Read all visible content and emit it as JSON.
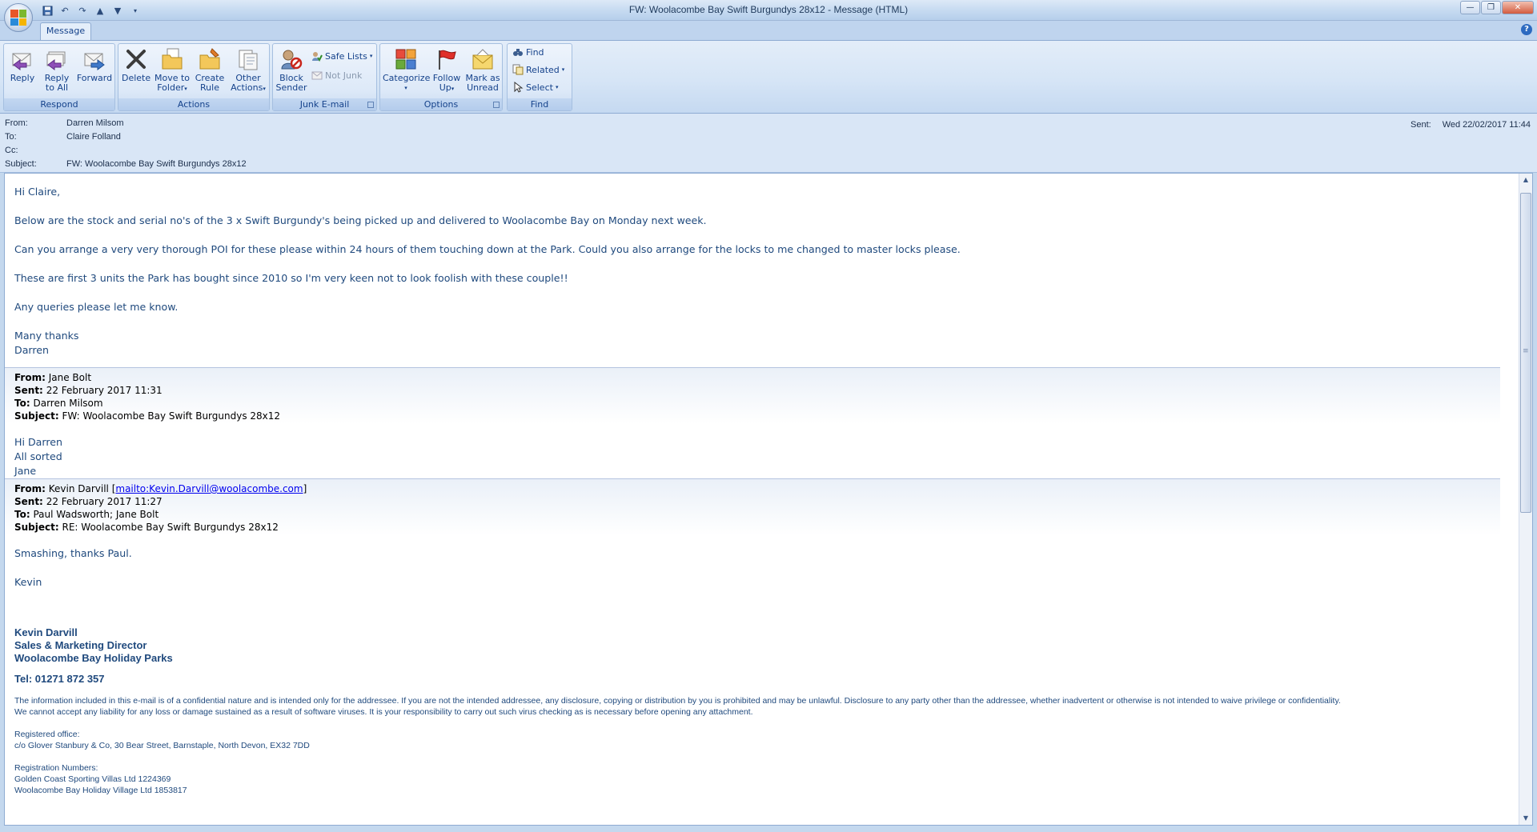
{
  "window": {
    "title": "FW: Woolacombe Bay  Swift Burgundys 28x12  -  Message (HTML)"
  },
  "tabs": [
    {
      "label": "Message"
    }
  ],
  "ribbon": {
    "respond": {
      "label": "Respond",
      "reply": "Reply",
      "reply_all_1": "Reply",
      "reply_all_2": "to All",
      "forward": "Forward"
    },
    "actions": {
      "label": "Actions",
      "delete": "Delete",
      "move_1": "Move to",
      "move_2": "Folder",
      "create_1": "Create",
      "create_2": "Rule",
      "other_1": "Other",
      "other_2": "Actions"
    },
    "junk": {
      "label": "Junk E-mail",
      "block_1": "Block",
      "block_2": "Sender",
      "safe_lists": "Safe Lists",
      "not_junk": "Not Junk"
    },
    "options": {
      "label": "Options",
      "categorize": "Categorize",
      "follow_1": "Follow",
      "follow_2": "Up",
      "mark_1": "Mark as",
      "mark_2": "Unread"
    },
    "find": {
      "label": "Find",
      "find": "Find",
      "related": "Related",
      "select": "Select"
    }
  },
  "header": {
    "from_label": "From:",
    "from": "Darren Milsom",
    "to_label": "To:",
    "to": "Claire Folland",
    "cc_label": "Cc:",
    "cc": "",
    "subject_label": "Subject:",
    "subject": "FW: Woolacombe Bay  Swift Burgundys 28x12",
    "sent_label": "Sent:",
    "sent": "Wed 22/02/2017 11:44"
  },
  "message": {
    "greeting": "Hi Claire,",
    "p1": "Below are the stock and serial no's of the 3 x Swift Burgundy's being picked up and delivered to Woolacombe Bay on Monday next week.",
    "p2": "Can you arrange a very very thorough POI for these please within 24 hours of them touching down at the Park. Could you also arrange for the locks to me changed to master locks please.",
    "p3": "These are first 3 units the Park has bought since 2010 so I'm very keen not to look foolish with these couple!!",
    "p4": "Any queries please let me know.",
    "signoff": "Many thanks",
    "name": "Darren"
  },
  "quote1": {
    "from_label": "From:",
    "from": "Jane Bolt",
    "sent_label": "Sent:",
    "sent": "22 February 2017 11:31",
    "to_label": "To:",
    "to": "Darren Milsom",
    "subject_label": "Subject:",
    "subject": "FW: Woolacombe Bay Swift Burgundys 28x12",
    "line1": "Hi Darren",
    "line2": "All sorted",
    "line3": "Jane"
  },
  "quote2": {
    "from_label": "From:",
    "from": "Kevin Darvill [",
    "from_link": "mailto:Kevin.Darvill@woolacombe.com",
    "from_end": "]",
    "sent_label": "Sent:",
    "sent": "22 February 2017 11:27",
    "to_label": "To:",
    "to": "Paul Wadsworth; Jane Bolt",
    "subject_label": "Subject:",
    "subject": "RE: Woolacombe Bay Swift Burgundys 28x12",
    "line1": "Smashing, thanks Paul.",
    "line2": "Kevin"
  },
  "signature": {
    "name": "Kevin Darvill",
    "title": "Sales & Marketing Director",
    "company": "Woolacombe Bay Holiday Parks",
    "tel": "Tel: 01271 872 357",
    "disclaimer1": "The information included in this e-mail is of a confidential nature and is intended only for the addressee. If you are not the intended addressee, any disclosure, copying or distribution by you is prohibited and may be unlawful. Disclosure to any party other than the addressee, whether inadvertent or otherwise is not intended to waive privilege or confidentiality.",
    "disclaimer2": "We cannot accept any liability for any loss or damage sustained as a result of software viruses. It is your responsibility to carry out such virus checking as is necessary before opening any attachment.",
    "reg_office_label": "Registered office:",
    "reg_office": "c/o Glover Stanbury & Co, 30 Bear Street, Barnstaple, North Devon, EX32 7DD",
    "reg_numbers_label": "Registration Numbers:",
    "reg1": "Golden Coast Sporting Villas Ltd 1224369",
    "reg2": "Woolacombe Bay Holiday Village Ltd 1853817"
  }
}
